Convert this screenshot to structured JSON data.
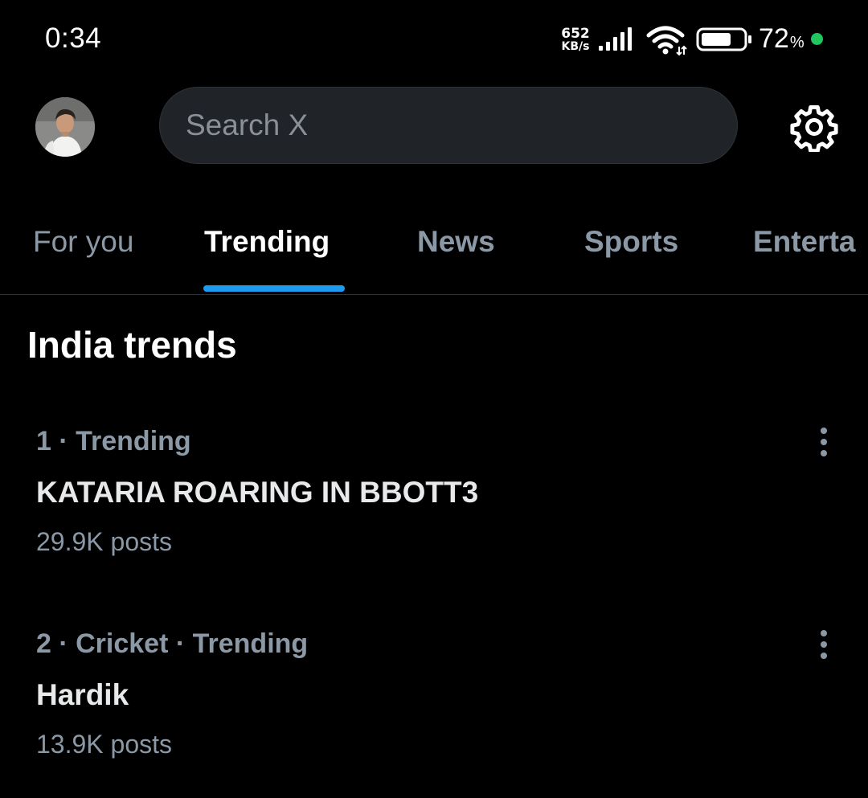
{
  "status_bar": {
    "time": "0:34",
    "net_speed_value": "652",
    "net_speed_unit": "KB/s",
    "signal_icon": "cell-signal-icon",
    "wifi_icon": "wifi-icon",
    "battery_icon": "battery-icon",
    "battery_level": "72",
    "battery_pct_sign": "%",
    "battery_fraction": 0.72,
    "status_dot_color": "#22c55e"
  },
  "top_bar": {
    "avatar_icon": "profile-avatar",
    "search_placeholder": "Search X",
    "settings_icon": "gear-icon"
  },
  "tabs": [
    {
      "label": "For you",
      "active": false
    },
    {
      "label": "Trending",
      "active": true
    },
    {
      "label": "News",
      "active": false
    },
    {
      "label": "Sports",
      "active": false
    },
    {
      "label": "Enterta",
      "active": false
    }
  ],
  "section": {
    "title": "India trends"
  },
  "trends": [
    {
      "meta": "1 · Trending",
      "title": "KATARIA ROARING IN BBOTT3",
      "posts": "29.9K posts",
      "more_icon": "more-vertical-icon"
    },
    {
      "meta": "2 · Cricket · Trending",
      "title": "Hardik",
      "posts": "13.9K posts",
      "more_icon": "more-vertical-icon"
    }
  ],
  "colors": {
    "background": "#000000",
    "accent": "#1d9bf0",
    "text_primary": "#e7e9ea",
    "text_secondary": "#8b98a5",
    "search_bg": "#202327",
    "divider": "#2f3336"
  }
}
